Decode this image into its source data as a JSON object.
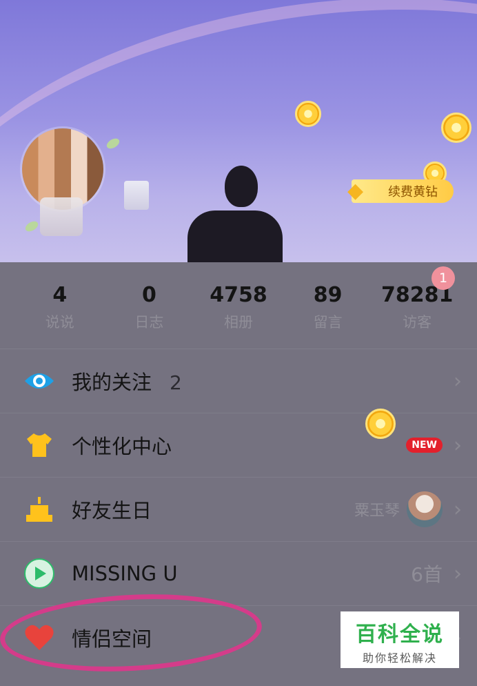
{
  "header": {
    "renew_label": "续费黄钻"
  },
  "stats": [
    {
      "value": "4",
      "label": "说说"
    },
    {
      "value": "0",
      "label": "日志"
    },
    {
      "value": "4758",
      "label": "相册"
    },
    {
      "value": "89",
      "label": "留言"
    },
    {
      "value": "78281",
      "label": "访客"
    }
  ],
  "notification_count": "1",
  "menu": [
    {
      "label": "我的关注",
      "count": "2",
      "icon": "eye-icon"
    },
    {
      "label": "个性化中心",
      "badge": "NEW",
      "icon": "tshirt-icon"
    },
    {
      "label": "好友生日",
      "friend_name": "粟玉琴",
      "icon": "cake-icon"
    },
    {
      "label": "MISSING U",
      "songs": "6首",
      "icon": "play-icon"
    },
    {
      "label": "情侣空间",
      "icon": "heart-icon"
    }
  ],
  "watermark": {
    "title": "百科全说",
    "subtitle": "助你轻松解决"
  },
  "colors": {
    "accent_blue": "#1ea0e6",
    "icon_yellow": "#ffc21c",
    "play_green": "#2dbb6a",
    "heart_red": "#e8433c",
    "annotation_pink": "#d43c8a"
  }
}
